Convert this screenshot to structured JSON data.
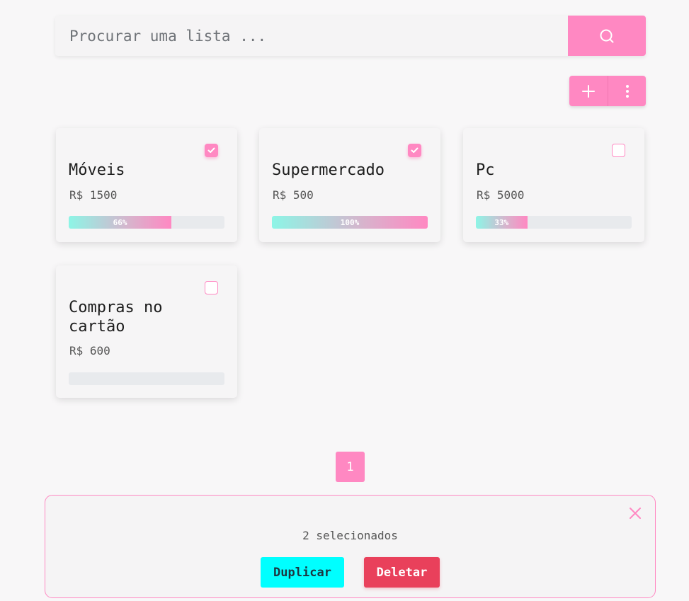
{
  "search": {
    "placeholder": "Procurar uma lista ..."
  },
  "icons": {
    "search": "search-icon",
    "add": "plus-icon",
    "more": "more-vertical-icon",
    "check": "check-icon",
    "close": "close-icon"
  },
  "colors": {
    "accent": "#ff88c2",
    "duplicate": "#00ffff",
    "delete": "#e9405b"
  },
  "lists": [
    {
      "title": "Móveis",
      "price": "R$ 1500",
      "progress": 66,
      "progress_label": "66%",
      "checked": true
    },
    {
      "title": "Supermercado",
      "price": "R$ 500",
      "progress": 100,
      "progress_label": "100%",
      "checked": true
    },
    {
      "title": "Pc",
      "price": "R$ 5000",
      "progress": 33,
      "progress_label": "33%",
      "checked": false
    },
    {
      "title": "Compras no cartão",
      "price": "R$ 600",
      "progress": 0,
      "progress_label": "",
      "checked": false
    }
  ],
  "pagination": {
    "current": "1"
  },
  "selection": {
    "count_label": "2 selecionados",
    "duplicate_label": "Duplicar",
    "delete_label": "Deletar"
  }
}
